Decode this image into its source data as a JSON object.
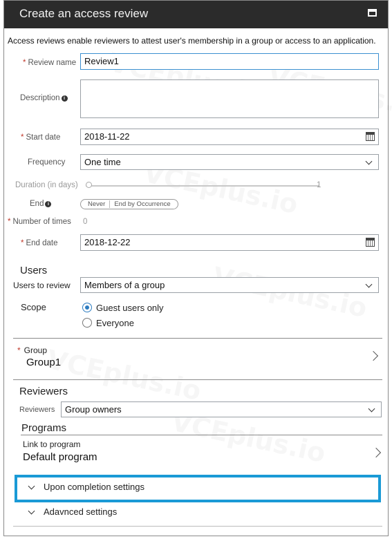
{
  "window": {
    "title": "Create an access review"
  },
  "intro_text": "Access reviews enable reviewers to attest user's membership in a group or access to an application.",
  "form": {
    "review_name": {
      "label": "Review name",
      "value": "Review1"
    },
    "description": {
      "label": "Description",
      "value": ""
    },
    "start_date": {
      "label": "Start date",
      "value": "2018-11-22"
    },
    "frequency": {
      "label": "Frequency",
      "value": "One time"
    },
    "duration": {
      "label": "Duration (in days)",
      "value": "1"
    },
    "end": {
      "label": "End",
      "options": [
        "Never",
        "End by Occurrence"
      ]
    },
    "number_of_times": {
      "label": "Number of times",
      "value": "0"
    },
    "end_date": {
      "label": "End date",
      "value": "2018-12-22"
    }
  },
  "users": {
    "section_title": "Users",
    "users_to_review": {
      "label": "Users to review",
      "value": "Members of a group"
    },
    "scope": {
      "label": "Scope",
      "options": [
        {
          "label": "Guest users only",
          "checked": true
        },
        {
          "label": "Everyone",
          "checked": false
        }
      ]
    }
  },
  "group": {
    "label": "Group",
    "value": "Group1"
  },
  "reviewers": {
    "section_title": "Reviewers",
    "label": "Reviewers",
    "value": "Group owners"
  },
  "programs": {
    "section_title": "Programs",
    "link_label": "Link to program",
    "value": "Default program"
  },
  "collapsibles": {
    "upon_completion": "Upon completion settings",
    "advanced": "Adavnced settings"
  },
  "watermark": "VCEplus.io",
  "colors": {
    "titlebar": "#2b2b2b",
    "required": "#c0392b",
    "highlight": "#1a9ad6",
    "radio_selected": "#2d7cc0"
  }
}
